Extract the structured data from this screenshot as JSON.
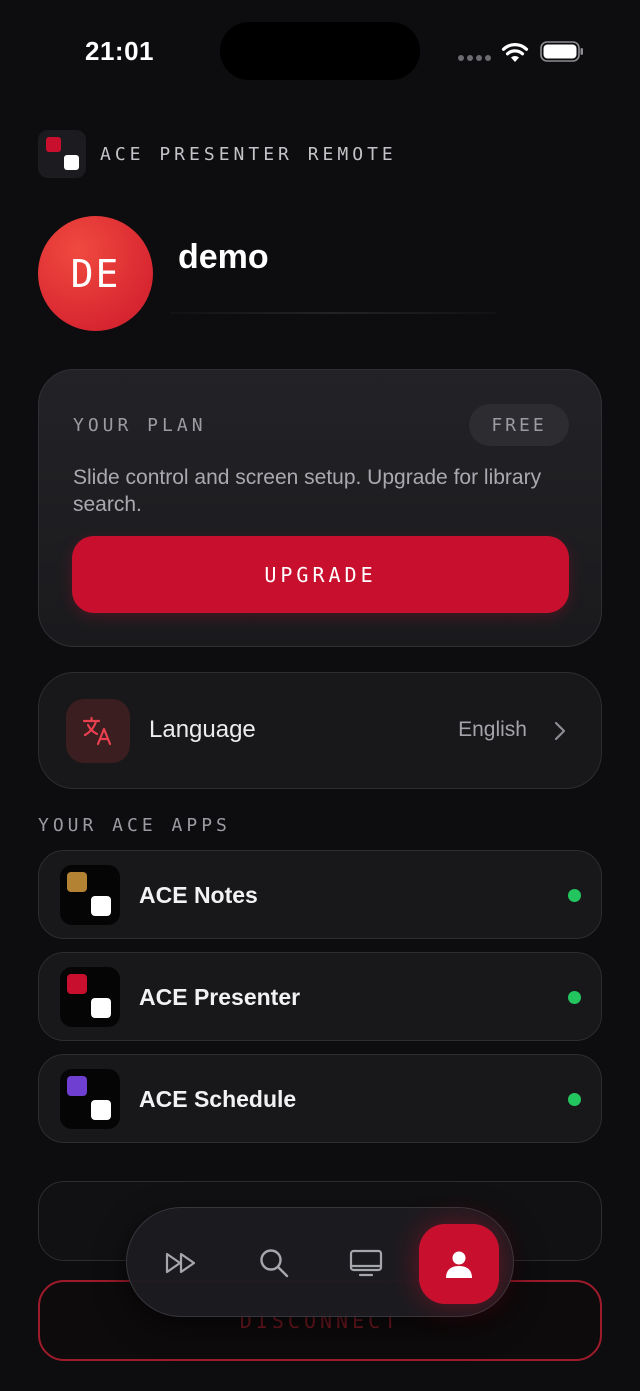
{
  "status_bar": {
    "time": "21:01"
  },
  "brand": {
    "name": "ACE PRESENTER REMOTE",
    "accent": "#c8102e"
  },
  "profile": {
    "initials": "DE",
    "username": "demo"
  },
  "plan": {
    "label": "YOUR PLAN",
    "badge": "FREE",
    "description": "Slide control and screen setup. Upgrade for library search.",
    "upgrade_label": "UPGRADE"
  },
  "language": {
    "label": "Language",
    "value": "English",
    "icon": "translate-icon"
  },
  "apps_section": {
    "title": "YOUR ACE APPS",
    "apps": [
      {
        "name": "ACE Notes",
        "color": "#b38232",
        "status_color": "#22c55e"
      },
      {
        "name": "ACE Presenter",
        "color": "#c8102e",
        "status_color": "#22c55e"
      },
      {
        "name": "ACE Schedule",
        "color": "#6e3fd0",
        "status_color": "#22c55e"
      }
    ]
  },
  "disconnect_label": "DISCONNECT",
  "tab_bar": {
    "tabs": [
      {
        "icon": "fast-forward-icon"
      },
      {
        "icon": "search-icon"
      },
      {
        "icon": "monitor-icon"
      },
      {
        "icon": "profile-icon",
        "active": true
      }
    ]
  }
}
